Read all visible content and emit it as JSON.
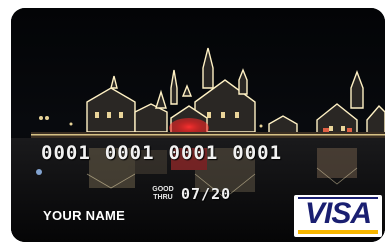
{
  "card": {
    "number_groups": [
      "0001",
      "0001",
      "0001",
      "0001"
    ],
    "good_thru_line1": "GOOD",
    "good_thru_line2": "THRU",
    "expiry": "07/20",
    "holder_name": "YOUR NAME",
    "network": "VISA"
  },
  "colors": {
    "visa_blue": "#1a1f71",
    "visa_gold": "#f7b600",
    "sky": "#050608",
    "lights": "#fff2c8"
  }
}
